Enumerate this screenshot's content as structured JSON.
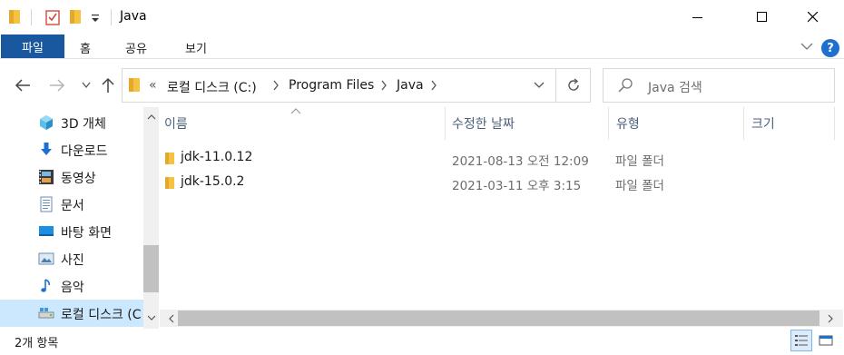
{
  "window": {
    "title": "Java",
    "controls": [
      "minimize",
      "maximize",
      "close"
    ]
  },
  "ribbon": {
    "tabs": [
      {
        "label": "파일",
        "active": true
      },
      {
        "label": "홈"
      },
      {
        "label": "공유"
      },
      {
        "label": "보기"
      }
    ],
    "help_label": "?"
  },
  "address": {
    "overflow": "«",
    "crumbs": [
      "로컬 디스크 (C:)",
      "Program Files",
      "Java"
    ]
  },
  "search": {
    "placeholder": "Java 검색"
  },
  "sidebar": {
    "items": [
      {
        "label": "3D 개체",
        "icon": "3d-objects-icon"
      },
      {
        "label": "다운로드",
        "icon": "download-icon"
      },
      {
        "label": "동영상",
        "icon": "video-icon"
      },
      {
        "label": "문서",
        "icon": "document-icon"
      },
      {
        "label": "바탕 화면",
        "icon": "desktop-icon"
      },
      {
        "label": "사진",
        "icon": "picture-icon"
      },
      {
        "label": "음악",
        "icon": "music-icon"
      },
      {
        "label": "로컬 디스크 (C:)",
        "icon": "drive-icon",
        "selected": true
      }
    ]
  },
  "columns": {
    "name": "이름",
    "date": "수정한 날짜",
    "type": "유형",
    "size": "크기"
  },
  "files": [
    {
      "name": "jdk-11.0.12",
      "date": "2021-08-13 오전 12:09",
      "type": "파일 폴더"
    },
    {
      "name": "jdk-15.0.2",
      "date": "2021-03-11 오후 3:15",
      "type": "파일 폴더"
    }
  ],
  "status": {
    "count": "2개 항목"
  },
  "colors": {
    "accent": "#19589e",
    "folder": "#f5c242",
    "selection": "#cce8ff"
  }
}
